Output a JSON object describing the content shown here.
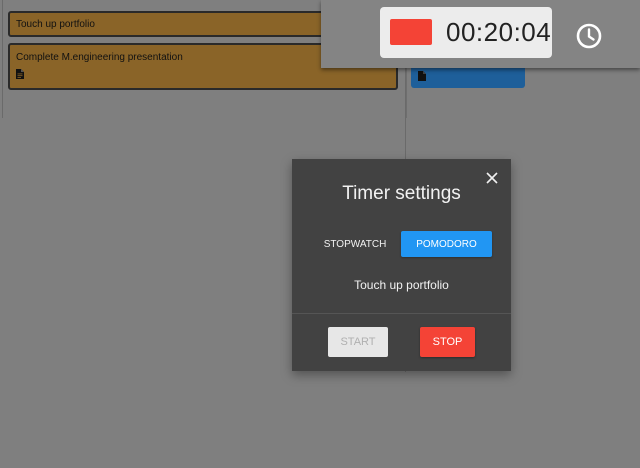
{
  "board": {
    "cards": [
      {
        "title": "Touch up portfolio"
      },
      {
        "title": "Complete M.engineering presentation",
        "icon": "document-icon"
      }
    ],
    "blue_card": {
      "icon": "document-icon"
    }
  },
  "timer": {
    "display": "00:20:04",
    "indicator_color": "#f44336",
    "icon": "clock-icon"
  },
  "modal": {
    "title": "Timer settings",
    "modes": {
      "stopwatch": "STOPWATCH",
      "pomodoro": "POMODORO",
      "active": "pomodoro"
    },
    "task": "Touch up portfolio",
    "start_label": "START",
    "stop_label": "STOP",
    "close_icon": "close-icon"
  },
  "colors": {
    "accent_blue": "#2196f3",
    "stop_red": "#f44336",
    "card_brown": "#8a6428",
    "card_blue": "#1e5f9a"
  }
}
